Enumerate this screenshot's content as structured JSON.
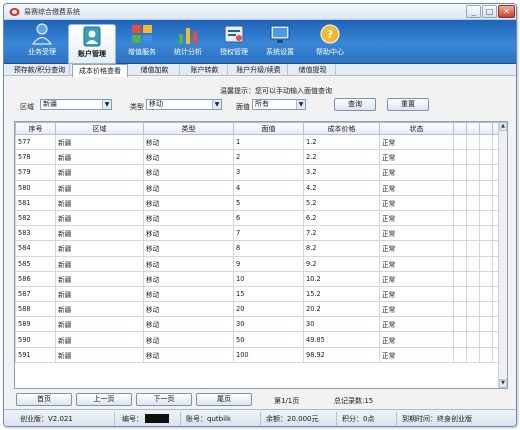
{
  "window": {
    "title": "易赛综合缴费系统",
    "controls": {
      "minimize": "_",
      "maximize": "□",
      "close": "✕"
    }
  },
  "ribbon": [
    {
      "label": "业务受理",
      "icon": "business-handling-icon"
    },
    {
      "label": "账户管理",
      "icon": "account-management-icon",
      "active": true
    },
    {
      "label": "增值服务",
      "icon": "value-added-icon"
    },
    {
      "label": "统计分析",
      "icon": "statistics-icon"
    },
    {
      "label": "授权管理",
      "icon": "authorization-icon"
    },
    {
      "label": "系统设置",
      "icon": "settings-icon"
    },
    {
      "label": "帮助中心",
      "icon": "help-icon"
    }
  ],
  "subtabs": [
    {
      "label": "预存款/积分查询"
    },
    {
      "label": "成本价格查看",
      "active": true
    },
    {
      "label": "储值加款"
    },
    {
      "label": "账户转款"
    },
    {
      "label": "账户升级/续费"
    },
    {
      "label": "储值提现"
    }
  ],
  "hint": "温馨提示：您可以手动输入面值查询",
  "filters": {
    "region": {
      "label": "区域",
      "value": "新疆"
    },
    "type": {
      "label": "类型",
      "value": "移动"
    },
    "face_value": {
      "label": "面值",
      "value": "所有"
    },
    "query_label": "查询",
    "reset_label": "重置"
  },
  "table": {
    "columns": [
      "序号",
      "区域",
      "类型",
      "面值",
      "成本价格",
      "状态"
    ],
    "rows": [
      [
        "577",
        "新疆",
        "移动",
        "1",
        "1.2",
        "正常"
      ],
      [
        "578",
        "新疆",
        "移动",
        "2",
        "2.2",
        "正常"
      ],
      [
        "579",
        "新疆",
        "移动",
        "3",
        "3.2",
        "正常"
      ],
      [
        "580",
        "新疆",
        "移动",
        "4",
        "4.2",
        "正常"
      ],
      [
        "581",
        "新疆",
        "移动",
        "5",
        "5.2",
        "正常"
      ],
      [
        "582",
        "新疆",
        "移动",
        "6",
        "6.2",
        "正常"
      ],
      [
        "583",
        "新疆",
        "移动",
        "7",
        "7.2",
        "正常"
      ],
      [
        "584",
        "新疆",
        "移动",
        "8",
        "8.2",
        "正常"
      ],
      [
        "585",
        "新疆",
        "移动",
        "9",
        "9.2",
        "正常"
      ],
      [
        "586",
        "新疆",
        "移动",
        "10",
        "10.2",
        "正常"
      ],
      [
        "587",
        "新疆",
        "移动",
        "15",
        "15.2",
        "正常"
      ],
      [
        "588",
        "新疆",
        "移动",
        "20",
        "20.2",
        "正常"
      ],
      [
        "589",
        "新疆",
        "移动",
        "30",
        "30",
        "正常"
      ],
      [
        "590",
        "新疆",
        "移动",
        "50",
        "49.85",
        "正常"
      ],
      [
        "591",
        "新疆",
        "移动",
        "100",
        "98.92",
        "正常"
      ]
    ]
  },
  "pager": {
    "first": "首页",
    "prev": "上一页",
    "next": "下一页",
    "last": "尾页",
    "page_info": "第1/1页",
    "total_info": "总记录数:15"
  },
  "status": {
    "edition": "创业版：V2.021",
    "account_no_label": "编号：",
    "account_label": "账号：qutbilk",
    "balance": "余额：20.000元",
    "points": "积分：0点",
    "expiry": "到期时间：终身创业版"
  },
  "colors": {
    "ribbon": "#2c74c4",
    "accent": "#1d63b8",
    "grid_border": "#8c9fb8"
  }
}
